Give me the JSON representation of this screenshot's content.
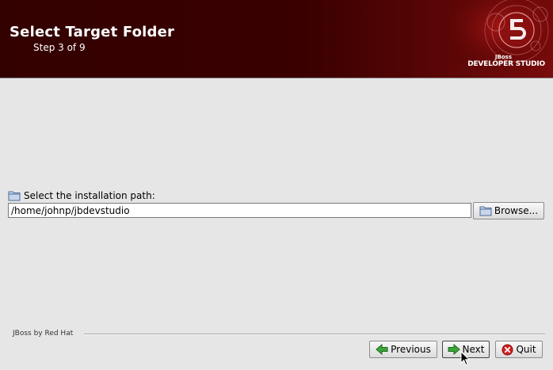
{
  "header": {
    "title": "Select Target Folder",
    "step": "Step 3 of 9",
    "brand_small": "JBoss",
    "brand_main": "DEVELOPER STUDIO"
  },
  "path": {
    "label": "Select the installation path:",
    "value": "/home/johnp/jbdevstudio",
    "browse_label": "Browse..."
  },
  "footer": {
    "vendor": "JBoss by Red Hat",
    "previous_label": "Previous",
    "next_label": "Next",
    "quit_label": "Quit"
  },
  "colors": {
    "header_bg": "#330000",
    "window_bg": "#e6e6e6",
    "arrow_green": "#2e9e2e",
    "quit_red": "#cc1111"
  },
  "icons": [
    "folder-icon",
    "arrow-left-icon",
    "arrow-right-icon",
    "quit-icon",
    "mouse-cursor-icon"
  ]
}
